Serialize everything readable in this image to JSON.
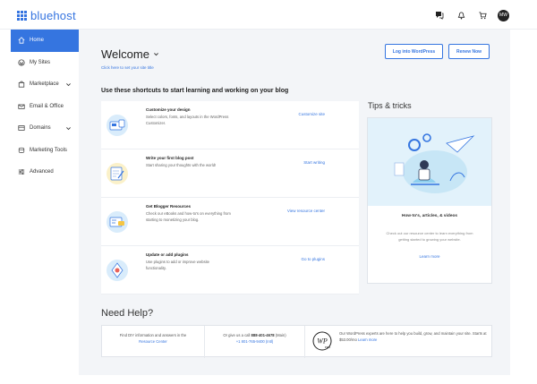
{
  "brand": {
    "name": "bluehost",
    "color": "#3574e0"
  },
  "topbar": {
    "icons": [
      "chat-icon",
      "bell-icon",
      "cart-icon"
    ],
    "avatar_initials": "MW"
  },
  "sidebar": {
    "items": [
      {
        "label": "Home",
        "icon": "home-icon",
        "active": true,
        "chevron": false
      },
      {
        "label": "My Sites",
        "icon": "wordpress-icon",
        "active": false,
        "chevron": false
      },
      {
        "label": "Marketplace",
        "icon": "bag-icon",
        "active": false,
        "chevron": true
      },
      {
        "label": "Email & Office",
        "icon": "mail-icon",
        "active": false,
        "chevron": false
      },
      {
        "label": "Domains",
        "icon": "domains-icon",
        "active": false,
        "chevron": true
      },
      {
        "label": "Marketing Tools",
        "icon": "marketing-icon",
        "active": false,
        "chevron": false
      },
      {
        "label": "Advanced",
        "icon": "sliders-icon",
        "active": false,
        "chevron": false
      }
    ]
  },
  "main": {
    "welcome": "Welcome",
    "welcome_link": "Click here to set your site title",
    "buttons": {
      "login_wp": "Log into WordPress",
      "renew": "Renew Now"
    },
    "shortcuts_title": "Use these shortcuts to start learning and working on your blog",
    "cards": [
      {
        "title": "Customize your design",
        "desc": "Select colors, fonts, and layouts in the WordPress Customizer.",
        "action": "Customize site"
      },
      {
        "title": "Write your first blog post",
        "desc": "Start sharing your thoughts with the world!",
        "action": "Start writing"
      },
      {
        "title": "Get Blogger Resources",
        "desc": "Check our eBooks and how-to's on everything from starting to monetizing your blog.",
        "action": "View resource center"
      },
      {
        "title": "Update or add plugins",
        "desc": "Use plugins to add or improve website functionality.",
        "action": "Go to plugins"
      }
    ],
    "tips": {
      "title": "Tips & tricks",
      "heading": "How-to's, articles, & videos",
      "desc": "Check out our resource center to learn everything from getting started to growing your website.",
      "link": "Learn more"
    },
    "help": {
      "title": "Need Help?",
      "col1_text": "Find DIY information and answers in the",
      "col1_link": "Resource Center",
      "col2_text": "Or give us a call",
      "col2_phone": "888-401-4678",
      "col2_suffix": "(Main)",
      "col2_intl": "+1 801-765-9400 (Intl)",
      "col3_text": "Our WordPress experts are here to help you build, grow, and maintain your site. Starts at $53.00/mo",
      "col3_link": "Learn more",
      "col3_logo_text": "WP",
      "col3_logo_sub": "PRO"
    }
  }
}
